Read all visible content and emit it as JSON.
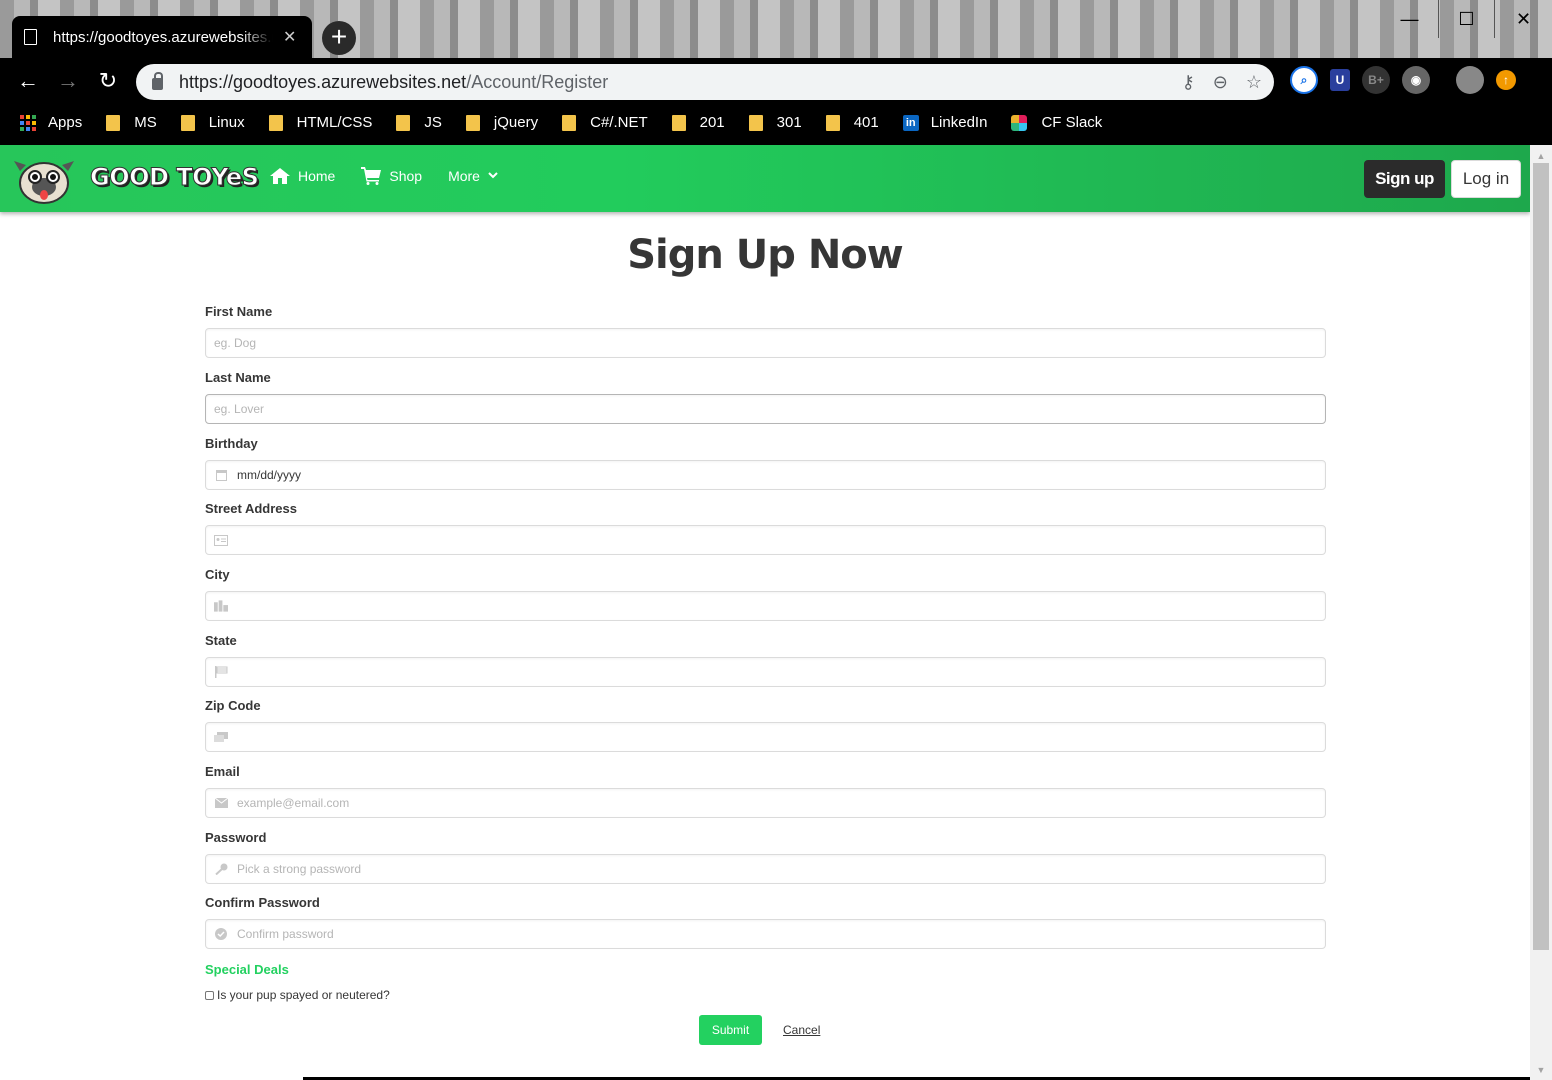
{
  "browser": {
    "tab_title": "https://goodtoyes.azurewebsites.net/Account/Register",
    "url_host": "https://goodtoyes.azurewebsites.net",
    "url_path": "/Account/Register",
    "bookmarks": [
      {
        "label": "Apps",
        "icon": "apps-grid-icon"
      },
      {
        "label": "MS",
        "icon": "folder-icon"
      },
      {
        "label": "Linux",
        "icon": "folder-icon"
      },
      {
        "label": "HTML/CSS",
        "icon": "folder-icon"
      },
      {
        "label": "JS",
        "icon": "folder-icon"
      },
      {
        "label": "jQuery",
        "icon": "folder-icon"
      },
      {
        "label": "C#/.NET",
        "icon": "folder-icon"
      },
      {
        "label": "201",
        "icon": "folder-icon"
      },
      {
        "label": "301",
        "icon": "folder-icon"
      },
      {
        "label": "401",
        "icon": "folder-icon"
      },
      {
        "label": "LinkedIn",
        "icon": "linkedin-icon"
      },
      {
        "label": "CF Slack",
        "icon": "slack-icon"
      }
    ]
  },
  "site": {
    "brand": "GOOD TOYeS",
    "nav": {
      "home": "Home",
      "shop": "Shop",
      "more": "More"
    },
    "signup": "Sign up",
    "login": "Log in",
    "accent_color": "#23d160"
  },
  "form": {
    "title": "Sign Up Now",
    "fields": [
      {
        "label": "First Name",
        "placeholder": "eg. Dog",
        "icon": ""
      },
      {
        "label": "Last Name",
        "placeholder": "eg. Lover",
        "icon": ""
      },
      {
        "label": "Birthday",
        "placeholder": "mm/dd/yyyy",
        "icon": "calendar-icon"
      },
      {
        "label": "Street Address",
        "placeholder": "",
        "icon": "address-card-icon"
      },
      {
        "label": "City",
        "placeholder": "",
        "icon": "city-icon"
      },
      {
        "label": "State",
        "placeholder": "",
        "icon": "flag-icon"
      },
      {
        "label": "Zip Code",
        "placeholder": "",
        "icon": "mail-bulk-icon"
      },
      {
        "label": "Email",
        "placeholder": "example@email.com",
        "icon": "envelope-icon"
      },
      {
        "label": "Password",
        "placeholder": "Pick a strong password",
        "icon": "key-icon"
      },
      {
        "label": "Confirm Password",
        "placeholder": "Confirm password",
        "icon": "check-circle-icon"
      }
    ],
    "special_deals": "Special Deals",
    "checkbox_label": "Is your pup spayed or neutered?",
    "submit": "Submit",
    "cancel": "Cancel"
  }
}
